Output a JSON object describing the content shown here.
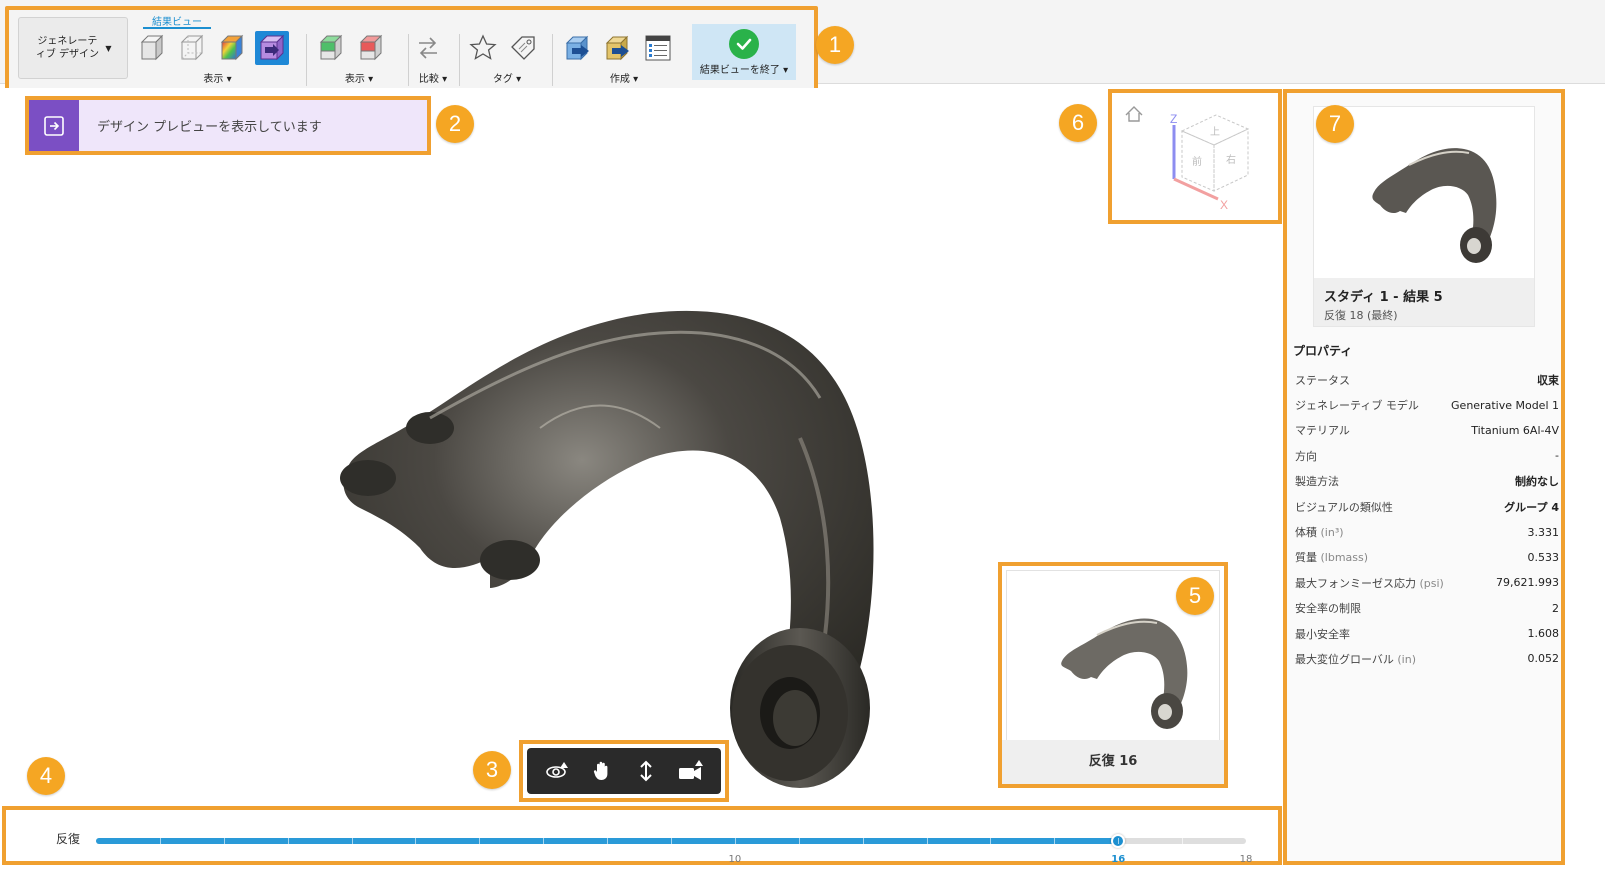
{
  "toolbar": {
    "workspace_label": "ジェネレーティブ デザイン",
    "tab_label": "結果ビュー",
    "groups": {
      "display1": "表示",
      "display2": "表示",
      "compare": "比較",
      "tags": "タグ",
      "create": "作成",
      "finish": "結果ビューを終了"
    }
  },
  "markers": [
    "1",
    "2",
    "3",
    "4",
    "5",
    "6",
    "7"
  ],
  "banner": {
    "text": "デザイン プレビューを表示しています"
  },
  "viewcube": {
    "z_label": "Z",
    "x_label": "X",
    "face_top": "上",
    "face_front": "前",
    "face_right": "右"
  },
  "preview": {
    "label": "反復 16"
  },
  "slider": {
    "label": "反復",
    "min": 0,
    "max": 18,
    "current": 16,
    "tick_labels": [
      "10",
      "16",
      "18"
    ],
    "tick_values": [
      10,
      16,
      18
    ]
  },
  "panel": {
    "card_title": "スタディ 1 - 結果 5",
    "card_subtitle": "反復 18 (最終)",
    "props_title": "プロパティ",
    "properties": [
      {
        "key": "ステータス",
        "unit": "",
        "value": "収束",
        "bold": true
      },
      {
        "key": "ジェネレーティブ モデル",
        "unit": "",
        "value": "Generative Model 1",
        "bold": false
      },
      {
        "key": "マテリアル",
        "unit": "",
        "value": "Titanium 6Al-4V",
        "bold": false
      },
      {
        "key": "方向",
        "unit": "",
        "value": "-",
        "bold": false
      },
      {
        "key": "製造方法",
        "unit": "",
        "value": "制約なし",
        "bold": true
      },
      {
        "key": "ビジュアルの類似性",
        "unit": "",
        "value": "グループ 4",
        "bold": true
      },
      {
        "key": "体積 ",
        "unit": "(in³)",
        "value": "3.331",
        "bold": false
      },
      {
        "key": "質量 ",
        "unit": "(lbmass)",
        "value": "0.533",
        "bold": false
      },
      {
        "key": "最大フォンミーゼス応力 ",
        "unit": "(psi)",
        "value": "79,621.993",
        "bold": false
      },
      {
        "key": "安全率の制限",
        "unit": "",
        "value": "2",
        "bold": false
      },
      {
        "key": "最小安全率",
        "unit": "",
        "value": "1.608",
        "bold": false
      },
      {
        "key": "最大変位グローバル ",
        "unit": "(in)",
        "value": "0.052",
        "bold": false
      }
    ]
  },
  "colors": {
    "accent": "#1c8fd0",
    "callout": "#f5a623",
    "banner_icon": "#7b4fc4",
    "success": "#2ab24a"
  }
}
